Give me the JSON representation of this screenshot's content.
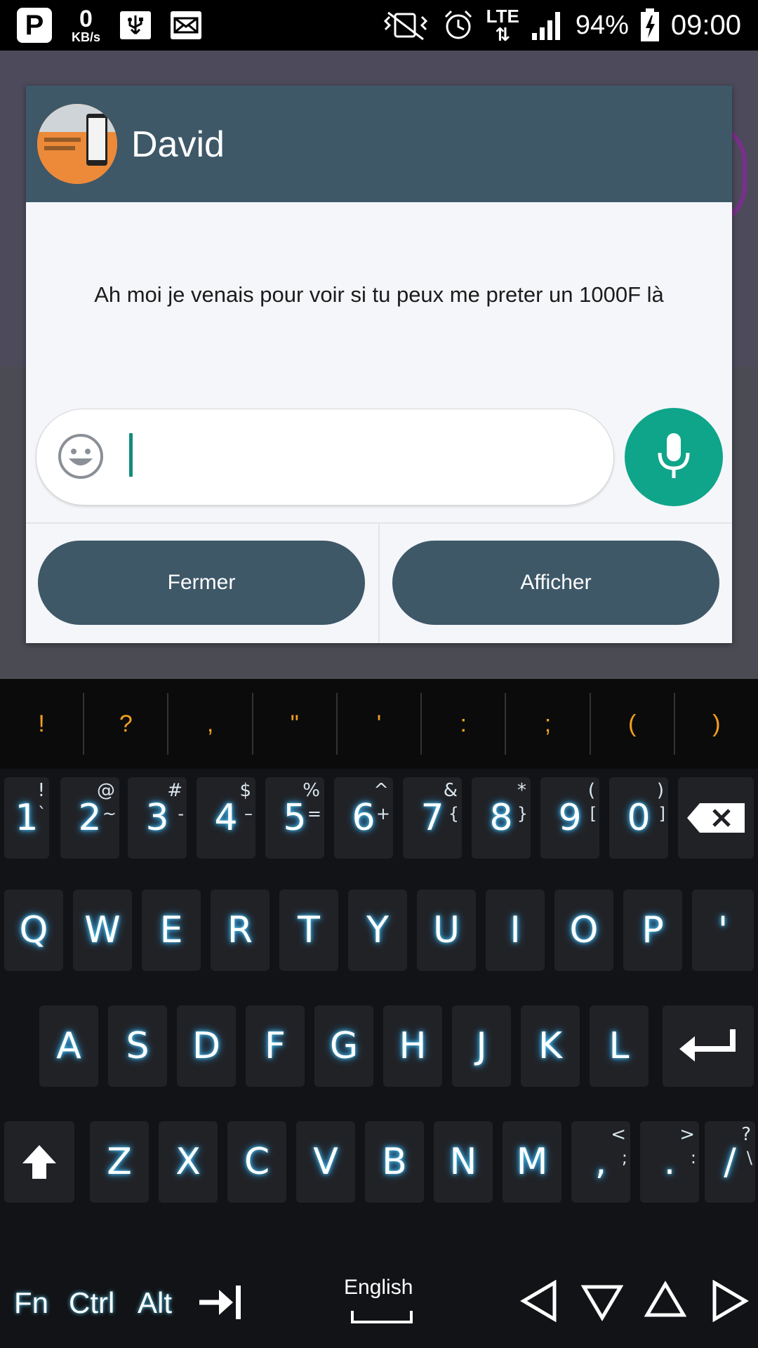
{
  "status_bar": {
    "net_speed": "0",
    "net_unit": "KB/s",
    "network": "LTE",
    "battery": "94%",
    "time": "09:00"
  },
  "dialog": {
    "contact_name": "David",
    "message": "Ah moi je venais pour voir si tu peux me preter un 1000F là",
    "input_value": "",
    "buttons": {
      "close": "Fermer",
      "show": "Afficher"
    }
  },
  "keyboard": {
    "symbols": [
      "!",
      "?",
      ",",
      "\"",
      "'",
      ":",
      ";",
      "(",
      ")"
    ],
    "number_row": [
      {
        "main": "1",
        "top": "!",
        "bottom": "`"
      },
      {
        "main": "2",
        "top": "@",
        "bottom": "~"
      },
      {
        "main": "3",
        "top": "#",
        "bottom": "-"
      },
      {
        "main": "4",
        "top": "$",
        "bottom": "–"
      },
      {
        "main": "5",
        "top": "%",
        "bottom": "="
      },
      {
        "main": "6",
        "top": "^",
        "bottom": "+"
      },
      {
        "main": "7",
        "top": "&",
        "bottom": "{"
      },
      {
        "main": "8",
        "top": "*",
        "bottom": "}"
      },
      {
        "main": "9",
        "top": "(",
        "bottom": "["
      },
      {
        "main": "0",
        "top": ")",
        "bottom": "]"
      }
    ],
    "row_q": [
      "Q",
      "W",
      "E",
      "R",
      "T",
      "Y",
      "U",
      "I",
      "O",
      "P",
      "'"
    ],
    "row_a": [
      "A",
      "S",
      "D",
      "F",
      "G",
      "H",
      "J",
      "K",
      "L"
    ],
    "row_z": [
      {
        "main": "Z"
      },
      {
        "main": "X"
      },
      {
        "main": "C"
      },
      {
        "main": "V"
      },
      {
        "main": "B"
      },
      {
        "main": "N"
      },
      {
        "main": "M"
      },
      {
        "main": ",",
        "top": "<",
        "bottom": ";"
      },
      {
        "main": ".",
        "top": ">",
        "bottom": ":"
      },
      {
        "main": "/",
        "top": "?",
        "bottom": "\\"
      }
    ],
    "fn_row": {
      "fn": "Fn",
      "ctrl": "Ctrl",
      "alt": "Alt",
      "language": "English"
    }
  },
  "colors": {
    "header": "#3e5868",
    "mic": "#0fa58a",
    "symbol_accent": "#f0a020"
  }
}
